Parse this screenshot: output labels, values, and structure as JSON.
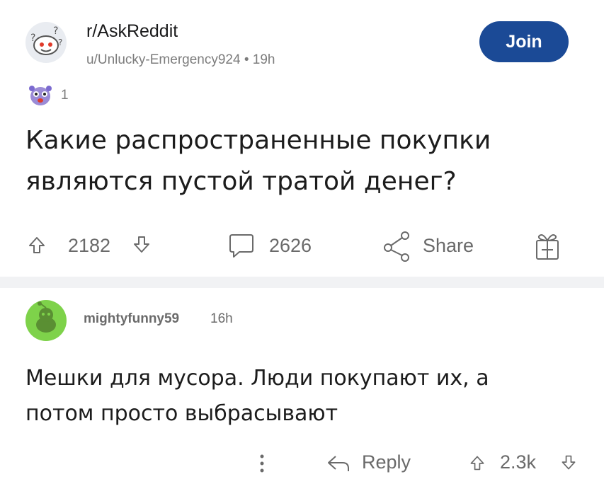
{
  "post": {
    "subreddit": "r/AskReddit",
    "author": "u/Unlucky-Emergency924",
    "separator": "•",
    "age": "19h",
    "join_label": "Join",
    "award_count": "1",
    "title": "Какие распространенные покупки являются пустой тратой денег?",
    "upvotes": "2182",
    "comments": "2626",
    "share_label": "Share"
  },
  "comment": {
    "username": "mightyfunny59",
    "age": "16h",
    "body": "Мешки для мусора. Люди покупают их, а потом просто выбрасывают",
    "reply_label": "Reply",
    "score": "2.3k"
  },
  "colors": {
    "join_bg": "#1b4a96",
    "meta_text": "#7c7c7c",
    "icon_gray": "#6a6a6a",
    "divider": "#f1f2f4",
    "user_avatar_green": "#7ed24a"
  },
  "icons": {
    "subreddit_avatar": "askreddit-snoo-icon",
    "award": "award-icon",
    "upvote": "arrow-up-icon",
    "downvote": "arrow-down-icon",
    "comment": "comment-bubble-icon",
    "share": "share-icon",
    "gift": "gift-icon",
    "more": "more-vertical-icon",
    "reply": "reply-arrow-icon"
  }
}
